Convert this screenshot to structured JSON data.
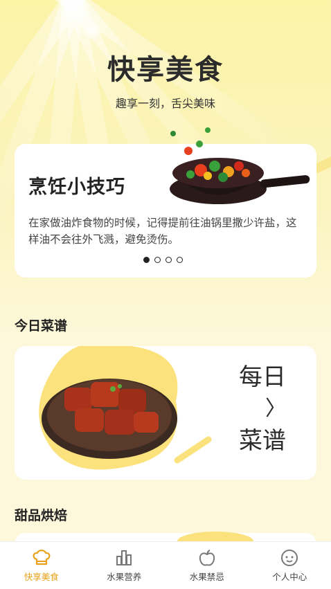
{
  "header": {
    "title": "快享美食",
    "subtitle": "趣享一刻，舌尖美味"
  },
  "tip_card": {
    "title": "烹饪小技巧",
    "text": "在家做油炸食物的时候，记得提前往油锅里撒少许盐，这样油不会往外飞溅，避免烫伤。",
    "pages": 4,
    "active_page": 1
  },
  "sections": {
    "today": "今日菜谱",
    "dessert": "甜品烘焙"
  },
  "recipe_card": {
    "line1": "每日",
    "arrow": "〉",
    "line2": "菜谱"
  },
  "tabs": [
    {
      "label": "快享美食",
      "icon": "chef-hat-icon",
      "active": true
    },
    {
      "label": "水果营养",
      "icon": "bar-chart-icon",
      "active": false
    },
    {
      "label": "水果禁忌",
      "icon": "apple-icon",
      "active": false
    },
    {
      "label": "个人中心",
      "icon": "face-icon",
      "active": false
    }
  ],
  "colors": {
    "accent": "#e8a21a",
    "background": "#fbf4c0",
    "card": "#ffffff"
  }
}
